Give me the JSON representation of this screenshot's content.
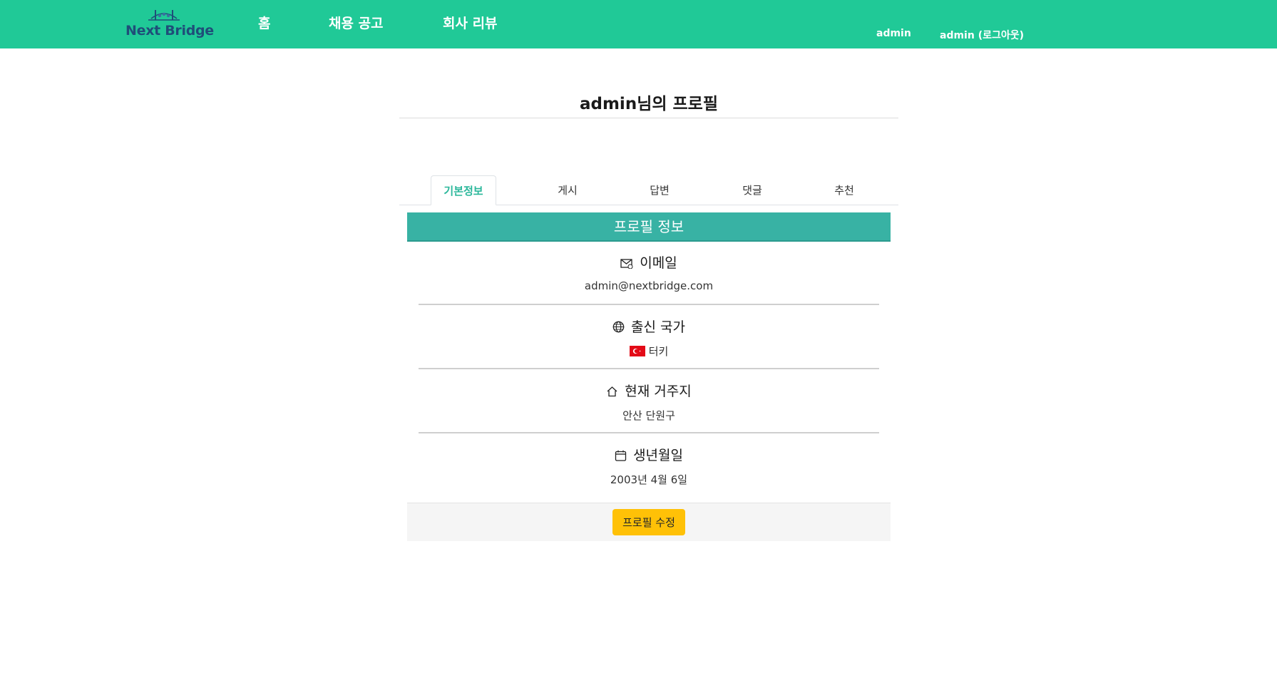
{
  "navbar": {
    "logo_text": "Next Bridge",
    "links": [
      {
        "label": "홈"
      },
      {
        "label": "채용 공고"
      },
      {
        "label": "회사 리뷰"
      }
    ],
    "user_label": "admin",
    "logout_label": "admin (로그아웃)",
    "background_color": "#20c997"
  },
  "profile": {
    "title": "admin님의 프로필",
    "tabs": [
      {
        "label": "기본정보",
        "active": true
      },
      {
        "label": "게시"
      },
      {
        "label": "답변"
      },
      {
        "label": "댓글"
      },
      {
        "label": "추천"
      }
    ],
    "card_header": "프로필 정보",
    "fields": [
      {
        "icon": "envelope-icon",
        "label": "이메일",
        "value": "admin@nextbridge.com"
      },
      {
        "icon": "globe-icon",
        "label": "출신 국가",
        "value": "터키",
        "flag": "turkey-flag-icon"
      },
      {
        "icon": "house-icon",
        "label": "현재 거주지",
        "value": "안산 단원구"
      },
      {
        "icon": "calendar-icon",
        "label": "생년월일",
        "value": "2003년 4월 6일"
      }
    ],
    "edit_button": "프로필 수정",
    "accent_color": "#38b2a4",
    "button_color": "#ffc107"
  }
}
